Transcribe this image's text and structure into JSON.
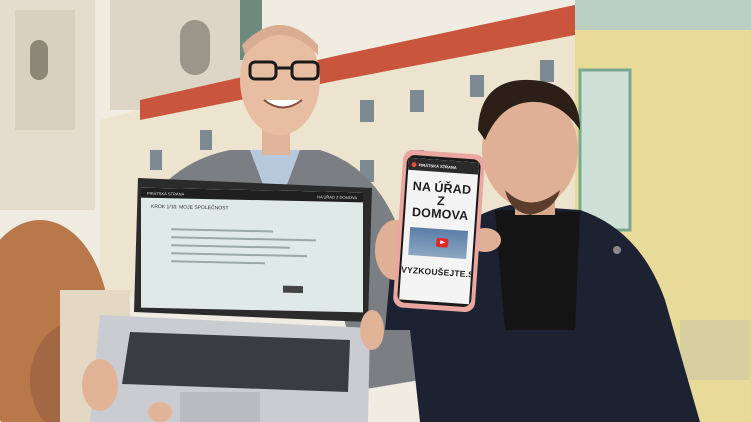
{
  "phone": {
    "brand": "PIRÁTSKÁ STRANA",
    "headline_line1": "NA ÚŘAD Z",
    "headline_line2": "DOMOVA",
    "cta": "VYZKOUŠEJTE.SI"
  },
  "laptop": {
    "brand": "PIRÁTSKÁ STRANA",
    "bar_title": "NA ÚŘAD Z DOMOVA",
    "page_title": "KROK 1/10: MOJE SPOLEČNOST"
  },
  "colors": {
    "sky": "#f1ede4",
    "building_cream": "#ece3cd",
    "building_yellow": "#e8db9a",
    "roof": "#c9553d",
    "jacket_gray": "#7b7e83",
    "jacket_navy": "#1d2233",
    "phone_case": "#e9a7a0"
  }
}
